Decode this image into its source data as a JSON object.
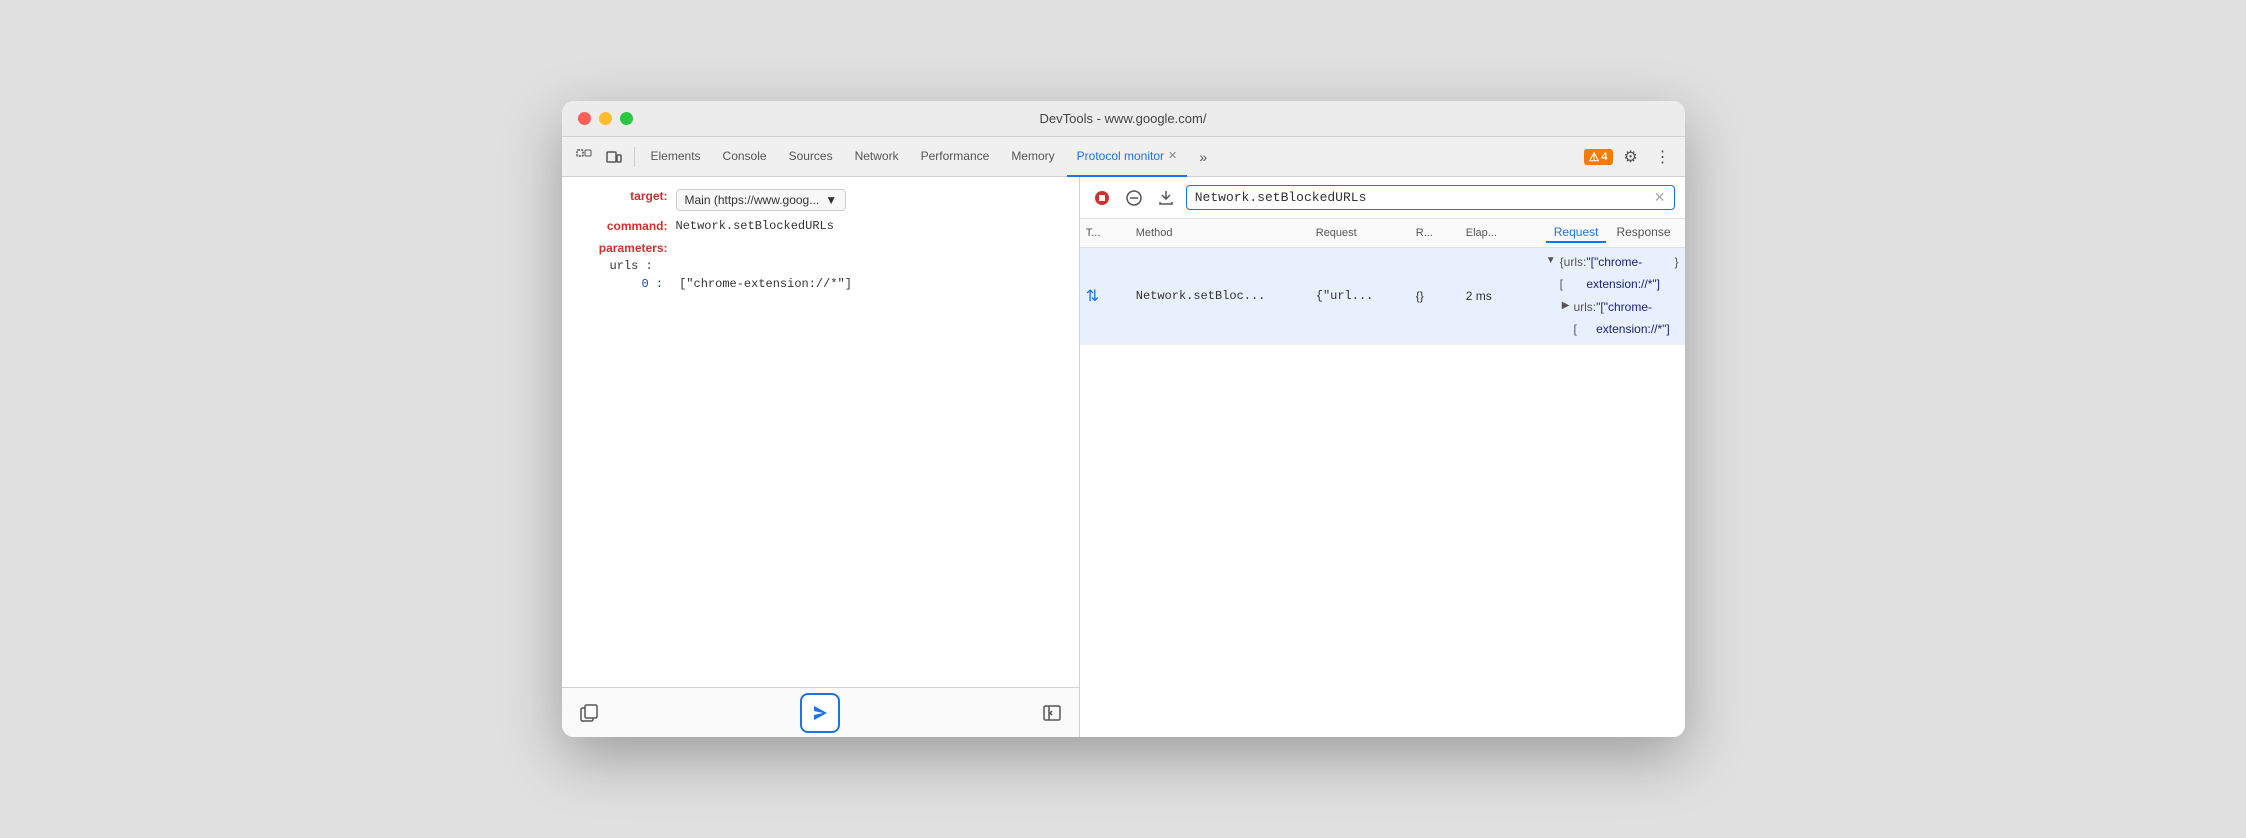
{
  "window": {
    "title": "DevTools - www.google.com/"
  },
  "toolbar": {
    "tabs": [
      {
        "id": "elements",
        "label": "Elements",
        "active": false
      },
      {
        "id": "console",
        "label": "Console",
        "active": false
      },
      {
        "id": "sources",
        "label": "Sources",
        "active": false
      },
      {
        "id": "network",
        "label": "Network",
        "active": false
      },
      {
        "id": "performance",
        "label": "Performance",
        "active": false
      },
      {
        "id": "memory",
        "label": "Memory",
        "active": false
      },
      {
        "id": "protocol-monitor",
        "label": "Protocol monitor",
        "active": true
      }
    ],
    "more_icon": "»",
    "notification_count": "4",
    "settings_icon": "⚙",
    "more_vert_icon": "⋮"
  },
  "left_panel": {
    "target_label": "target:",
    "target_value": "Main (https://www.goog...",
    "command_label": "command:",
    "command_value": "Network.setBlockedURLs",
    "parameters_label": "parameters:",
    "urls_label": "urls :",
    "index_label": "0 :",
    "index_value": "[\"chrome-extension://*\"]"
  },
  "command_bar": {
    "stop_icon": "⏹",
    "cancel_icon": "⊘",
    "download_icon": "⬇",
    "input_value": "Network.setBlockedURLs",
    "clear_icon": "✕"
  },
  "table": {
    "headers": {
      "t": "T...",
      "method": "Method",
      "request": "Request",
      "r": "R...",
      "elapsed": "Elap..."
    },
    "tabs": [
      {
        "id": "request",
        "label": "Request",
        "active": true
      },
      {
        "id": "response",
        "label": "Response",
        "active": false
      }
    ],
    "rows": [
      {
        "t": "↕",
        "method": "Network.setBloc...",
        "request": "{\"url...",
        "r": "{}",
        "elapsed": "2 ms"
      }
    ]
  },
  "detail": {
    "lines": [
      {
        "indent": 0,
        "expand": "▼",
        "content": "{urls: [\"[\"chrome-extension://*\"]}"
      },
      {
        "indent": 1,
        "expand": "▶",
        "content": "urls: [\"[\"chrome-extension://*\"]"
      }
    ]
  },
  "bottom_bar": {
    "copy_icon": "⧉",
    "send_icon": "▶",
    "sidebar_icon": "⊣"
  }
}
